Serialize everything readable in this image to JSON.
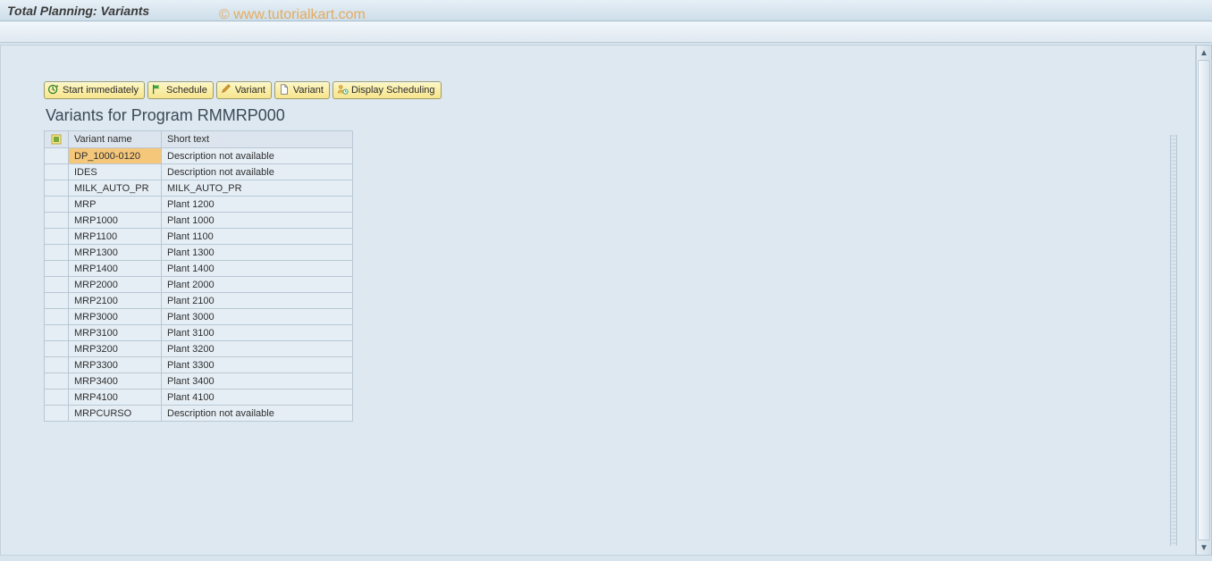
{
  "window": {
    "title": "Total Planning: Variants"
  },
  "watermark": "© www.tutorialkart.com",
  "toolbar": {
    "start_immediately": "Start immediately",
    "schedule": "Schedule",
    "variant_edit": "Variant",
    "variant_new": "Variant",
    "display_scheduling": "Display Scheduling"
  },
  "subtitle": "Variants for Program RMMRP000",
  "table": {
    "headers": {
      "name": "Variant name",
      "text": "Short text"
    },
    "rows": [
      {
        "name": "DP_1000-0120",
        "text": "Description not available",
        "selected": true
      },
      {
        "name": "IDES",
        "text": "Description not available"
      },
      {
        "name": "MILK_AUTO_PR",
        "text": "MILK_AUTO_PR"
      },
      {
        "name": "MRP",
        "text": "Plant 1200"
      },
      {
        "name": "MRP1000",
        "text": "Plant 1000"
      },
      {
        "name": "MRP1100",
        "text": "Plant 1100"
      },
      {
        "name": "MRP1300",
        "text": "Plant 1300"
      },
      {
        "name": "MRP1400",
        "text": "Plant 1400"
      },
      {
        "name": "MRP2000",
        "text": "Plant 2000"
      },
      {
        "name": "MRP2100",
        "text": "Plant 2100"
      },
      {
        "name": "MRP3000",
        "text": "Plant 3000"
      },
      {
        "name": "MRP3100",
        "text": "Plant 3100"
      },
      {
        "name": "MRP3200",
        "text": "Plant 3200"
      },
      {
        "name": "MRP3300",
        "text": "Plant 3300"
      },
      {
        "name": "MRP3400",
        "text": "Plant 3400"
      },
      {
        "name": "MRP4100",
        "text": "Plant 4100"
      },
      {
        "name": "MRPCURSO",
        "text": "Description not available"
      }
    ]
  }
}
